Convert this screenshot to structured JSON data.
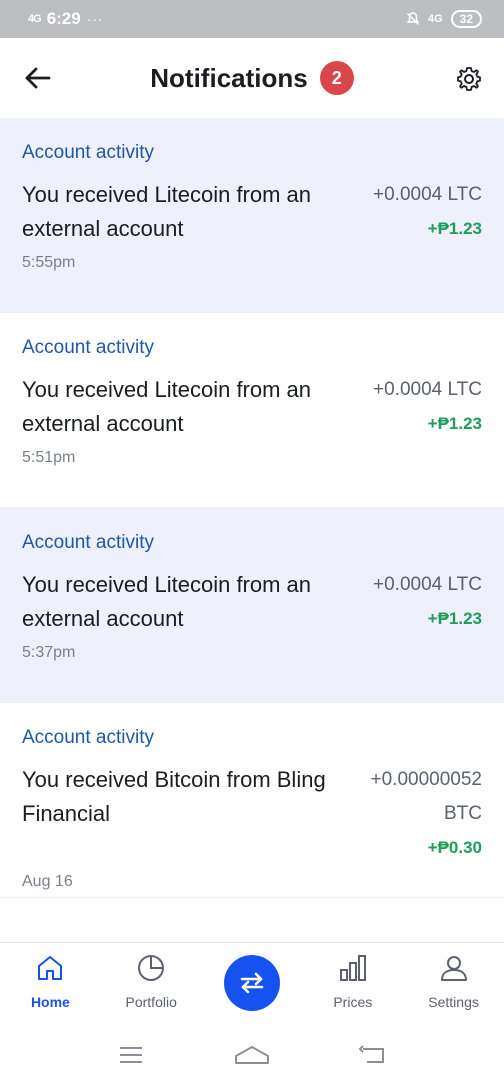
{
  "status_bar": {
    "signal": "4G",
    "time": "6:29",
    "dots": "···",
    "network": "4G",
    "battery": "32"
  },
  "header": {
    "title": "Notifications",
    "badge_count": "2",
    "back_icon": "arrow-left-icon",
    "settings_icon": "gear-icon"
  },
  "notifications": [
    {
      "category": "Account activity",
      "message": "You received Litecoin from an external account",
      "crypto_amount": "+0.0004 LTC",
      "fiat_amount": "+₱1.23",
      "time": "5:55pm",
      "unread": true
    },
    {
      "category": "Account activity",
      "message": "You received Litecoin from an external account",
      "crypto_amount": "+0.0004 LTC",
      "fiat_amount": "+₱1.23",
      "time": "5:51pm",
      "unread": false
    },
    {
      "category": "Account activity",
      "message": "You received Litecoin from an external account",
      "crypto_amount": "+0.0004 LTC",
      "fiat_amount": "+₱1.23",
      "time": "5:37pm",
      "unread": true
    },
    {
      "category": "Account activity",
      "message": "You received Bitcoin from Bling Financial",
      "crypto_amount": "+0.00000052 BTC",
      "fiat_amount": "+₱0.30",
      "time": "Aug 16",
      "unread": false
    }
  ],
  "bottom_nav": {
    "home": "Home",
    "portfolio": "Portfolio",
    "trade_icon": "swap-arrows-icon",
    "prices": "Prices",
    "settings": "Settings"
  },
  "colors": {
    "accent": "#1652f0",
    "category_text": "#1f56a8",
    "positive": "#1e9e5a",
    "badge": "#d9474d",
    "unread_bg": "#eef1fb"
  }
}
